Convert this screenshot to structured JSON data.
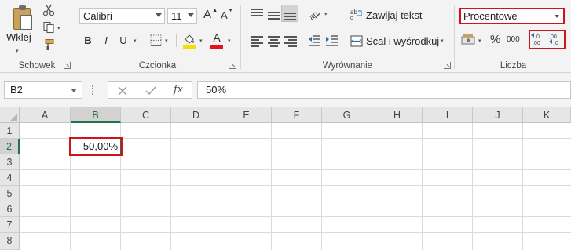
{
  "ribbon": {
    "clipboard": {
      "group_label": "Schowek",
      "paste_label": "Wklej",
      "icons": [
        "scissors-icon",
        "copy-icon",
        "format-painter-icon"
      ]
    },
    "font": {
      "group_label": "Czcionka",
      "font_name": "Calibri",
      "font_size": "11",
      "grow_label": "A",
      "shrink_label": "A",
      "bold": "B",
      "italic": "I",
      "underline": "U",
      "font_color_label": "A",
      "fill_color": "#f7e000",
      "font_color": "#e81123"
    },
    "alignment": {
      "group_label": "Wyrównanie",
      "wrap_text": "Zawijaj tekst",
      "merge_center": "Scal i wyśrodkuj"
    },
    "number": {
      "group_label": "Liczba",
      "format": "Procentowe",
      "percent_symbol": "%",
      "thousands_symbol": "000"
    }
  },
  "formula_bar": {
    "name_box": "B2",
    "formula": "50%",
    "fx_label": "fx"
  },
  "grid": {
    "columns": [
      "A",
      "B",
      "C",
      "D",
      "E",
      "F",
      "G",
      "H",
      "I",
      "J",
      "K"
    ],
    "rows": [
      "1",
      "2",
      "3",
      "4",
      "5",
      "6",
      "7",
      "8"
    ],
    "selected_column": "B",
    "selected_row": "2",
    "cell_b2": "50,00%"
  },
  "colors": {
    "accent": "#217346",
    "highlight": "#d0141b"
  }
}
